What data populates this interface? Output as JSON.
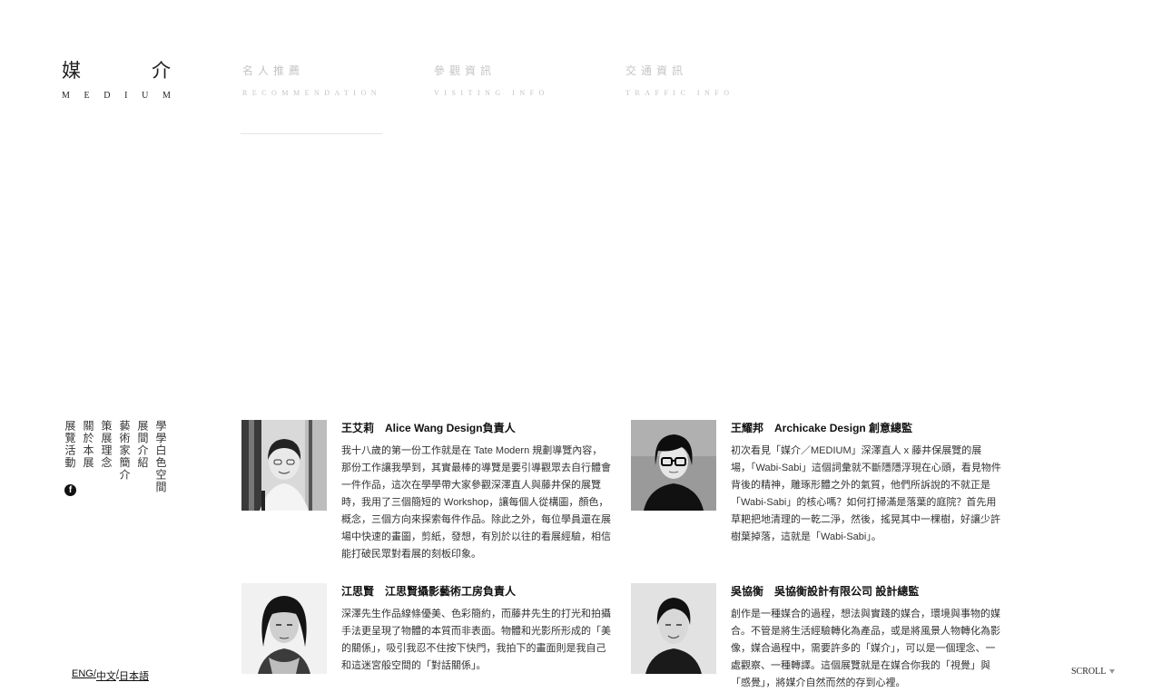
{
  "logo": {
    "zh": [
      "媒",
      "介"
    ],
    "en": [
      "M",
      "E",
      "D",
      "I",
      "U",
      "M"
    ]
  },
  "nav": [
    {
      "zh": "名人推薦",
      "en": "Recommendation"
    },
    {
      "zh": "參觀資訊",
      "en": "Visiting Info"
    },
    {
      "zh": "交通資訊",
      "en": "Traffic Info"
    }
  ],
  "side_menu": [
    "展覽活動",
    "關於本展",
    "策展理念",
    "藝術家簡介",
    "展間介紹",
    "學學白色空間"
  ],
  "social": {
    "facebook_icon": "facebook-icon",
    "facebook_glyph": "f"
  },
  "language": {
    "eng": "ENG",
    "zh": "中文",
    "ja": "日本語",
    "divider": " / "
  },
  "scroll": {
    "label": "SCROLL"
  },
  "recommendations": [
    {
      "name": "王艾莉",
      "role": "Alice Wang Design負責人",
      "text": "我十八歲的第一份工作就是在 Tate Modern 規劃導覽內容，那份工作讓我學到，其實最棒的導覽是要引導觀眾去自行體會一件作品，這次在學學帶大家參觀深澤直人與藤井保的展覽時，我用了三個簡短的 Workshop，讓每個人從構圖，顏色，概念，三個方向來探索每件作品。除此之外，每位學員還在展場中快速的畫圖，剪紙，發想，有別於以往的看展經驗，相信能打破民眾對看展的刻板印象。"
    },
    {
      "name": "王耀邦",
      "role": "Archicake Design 創意總監",
      "text": "初次看見「媒介／MEDIUM」深澤直人 x 藤井保展覽的展場，「Wabi-Sabi」這個詞彙就不斷隱隱浮現在心頭，看見物件背後的精神，雕琢形體之外的氣質，他們所訴說的不就正是「Wabi-Sabi」的核心嗎？如何打掃滿是落葉的庭院？首先用草耙把地清理的一乾二淨，然後，搖晃其中一棵樹，好讓少許樹葉掉落，這就是「Wabi-Sabi」。"
    },
    {
      "name": "江思賢",
      "role": "江思賢攝影藝術工房負責人",
      "text": "深澤先生作品線條優美、色彩簡約，而藤井先生的打光和拍攝手法更呈現了物體的本質而非表面。物體和光影所形成的「美的關係」，吸引我忍不住按下快門，我拍下的畫面則是我自己和這迷宮般空間的「對話關係」。"
    },
    {
      "name": "吳協衡",
      "role": "吳協衡設計有限公司 設計總監",
      "text": "創作是一種媒合的過程，想法與實踐的媒合，環境與事物的媒合。不管是將生活經驗轉化為產品，或是將風景人物轉化為影像，媒合過程中，需要許多的「媒介」，可以是一個理念、一處觀察、一種轉譯。這個展覽就是在媒合你我的「視覺」與「感覺」，將媒介自然而然的存到心裡。"
    }
  ]
}
